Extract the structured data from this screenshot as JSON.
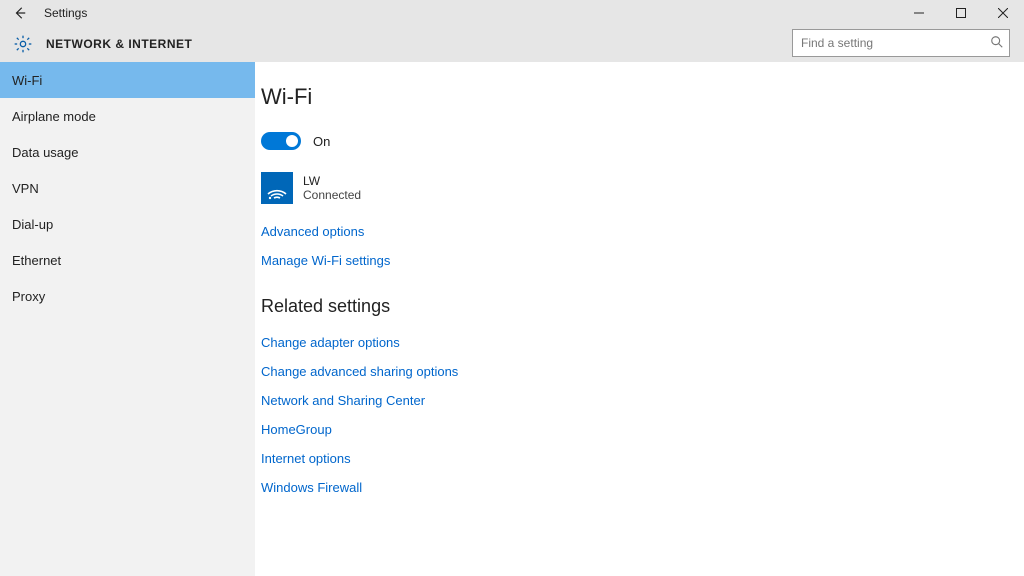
{
  "window": {
    "title": "Settings"
  },
  "header": {
    "section": "NETWORK & INTERNET",
    "search_placeholder": "Find a setting"
  },
  "sidebar": {
    "items": [
      {
        "label": "Wi-Fi",
        "active": true
      },
      {
        "label": "Airplane mode"
      },
      {
        "label": "Data usage"
      },
      {
        "label": "VPN"
      },
      {
        "label": "Dial-up"
      },
      {
        "label": "Ethernet"
      },
      {
        "label": "Proxy"
      }
    ]
  },
  "main": {
    "title": "Wi-Fi",
    "toggle": {
      "state_label": "On"
    },
    "network": {
      "name": "LW",
      "status": "Connected"
    },
    "links_primary": [
      "Advanced options",
      "Manage Wi-Fi settings"
    ],
    "related_heading": "Related settings",
    "links_related": [
      "Change adapter options",
      "Change advanced sharing options",
      "Network and Sharing Center",
      "HomeGroup",
      "Internet options",
      "Windows Firewall"
    ]
  }
}
